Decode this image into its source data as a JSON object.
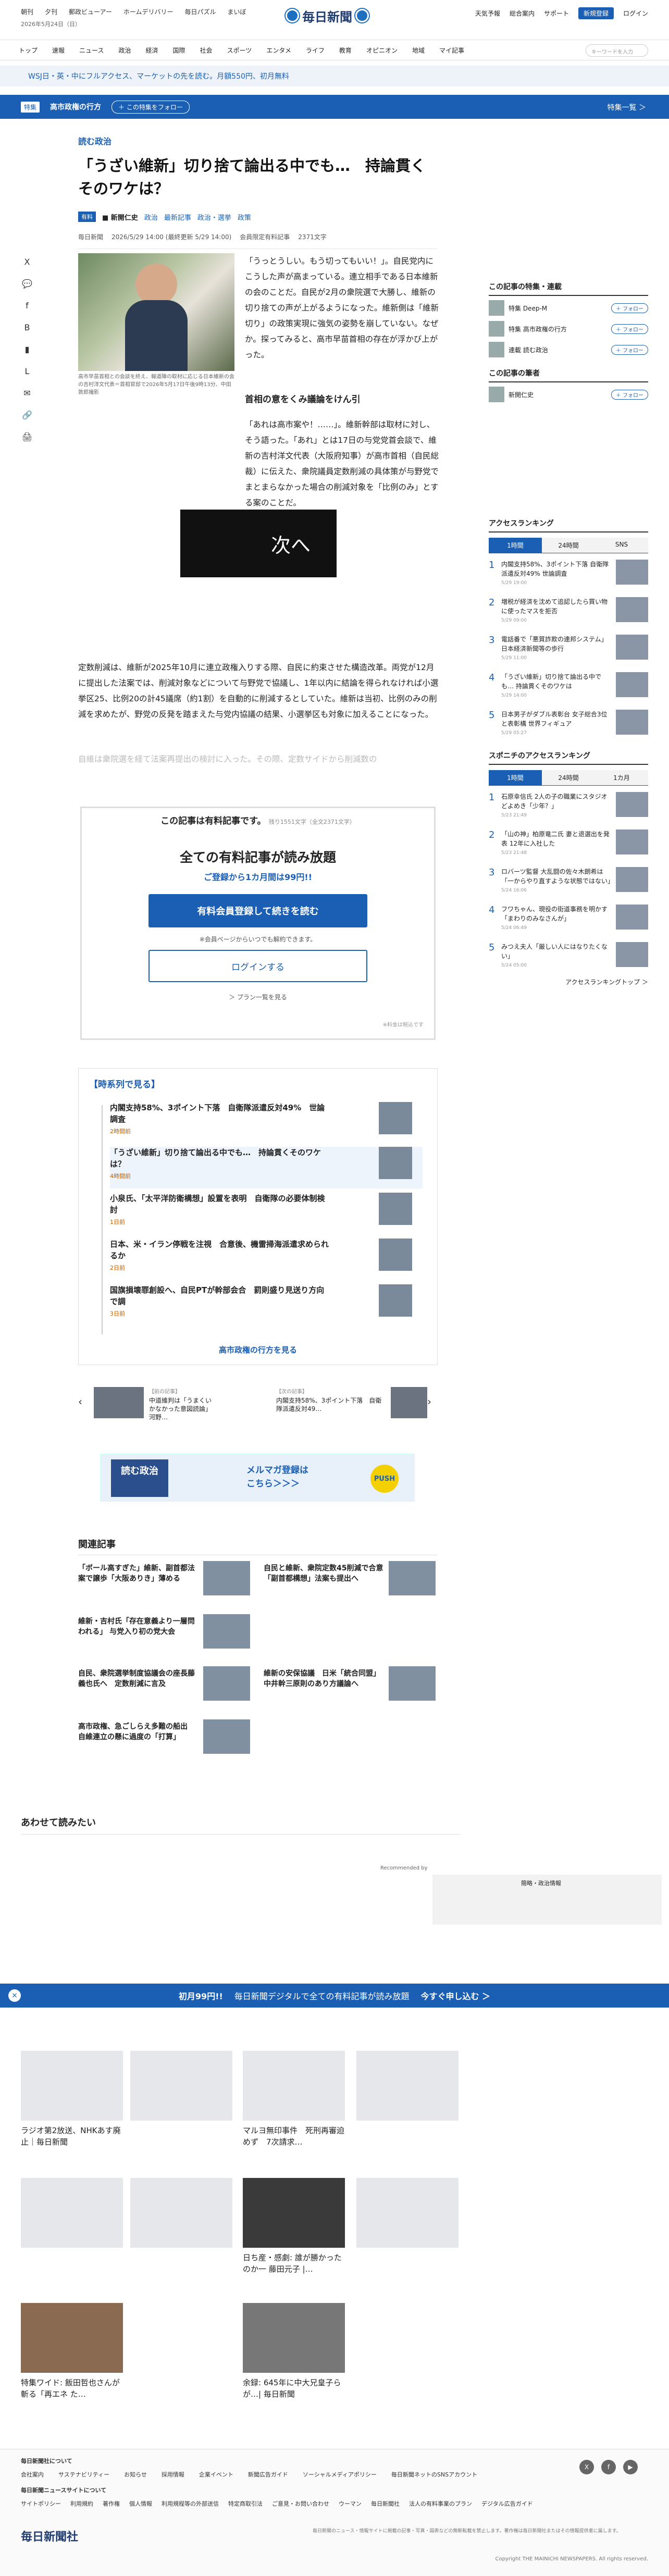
{
  "util": {
    "links": [
      "朝刊",
      "夕刊",
      "郵政ビューアー",
      "ホームデリバリー",
      "毎日パズル",
      "まいぼ"
    ],
    "date": "2026年5月24日（日）",
    "logo": "毎日新聞",
    "right": [
      "天気予報",
      "総合案内",
      "サポート"
    ],
    "register": "新規登録",
    "login": "ログイン"
  },
  "gnav": {
    "items": [
      "トップ",
      "速報",
      "ニュース",
      "政治",
      "経済",
      "国際",
      "社会",
      "スポーツ",
      "エンタメ",
      "ライフ",
      "教育",
      "オピニオン",
      "地域",
      "マイ記事"
    ],
    "search_placeholder": "キーワードを入力"
  },
  "ticker": "WSJ日・英・中にフルアクセス、マーケットの先を読む。月額550円、初月無料",
  "topic": {
    "tag": "特集",
    "name": "高市政権の行方",
    "follow": "＋ この特集をフォロー",
    "special": "特集一覧 ＞"
  },
  "article": {
    "kicker": "読む政治",
    "title": "「うざい維新」切り捨て論出る中でも…　持論貫くそのワケは？",
    "badge": "有料",
    "author": "■ 新開仁史",
    "tags": [
      "政治",
      "最新記事",
      "政治・選挙",
      "政策"
    ],
    "paper": "毎日新聞",
    "dates": "2026/5/29 14:00 (最終更新 5/29 14:00)",
    "members": "会員限定有料記事",
    "chars": "2371文字",
    "caption": "高市早苗首相との会談を終え、報道陣の取材に応じる日本維新の会の吉村洋文代表＝首相官邸で2026年5月17日午後9時13分、中田敦郎撮影",
    "lead": "「うっとうしい。もう切ってもいい！」。自民党内にこうした声が高まっている。連立相手である日本維新の会のことだ。自民が2月の衆院選で大勝し、維新の切り捨ての声が上がるようになった。維新側は「維新切り」の政策実現に強気の姿勢を崩していない。なぜか。探ってみると、高市早苗首相の存在が浮かび上がった。",
    "h2": "首相の意をくみ議論をけん引",
    "p2": "「あれは高市案や！……」。維新幹部は取材に対し、そう語った。「あれ」とは17日の与党党首会談で、維新の吉村洋文代表（大阪府知事）が高市首相（自民総裁）に伝えた、衆院議員定数削減の具体策が与野党でまとまらなかった場合の削減対象を「比例のみ」とする案のことだ。",
    "video": "次へ",
    "p4": "定数削減は、維新が2025年10月に連立政権入りする際、自民に約束させた構造改革。両党が12月に提出した法案では、削減対象などについて与野党で協議し、1年以内に結論を得られなければ小選挙区25、比例20の計45議席（約1割）を自動的に削減するとしていた。維新は当初、比例のみの削減を求めたが、野党の反発を踏まえた与党内協議の結果、小選挙区も対象に加えることになった。",
    "fade": "自維は衆院選を経て法案再提出の検討に入った。その際、定数サイドから削減数の"
  },
  "share": [
    "X",
    "f",
    "B",
    "L",
    "✉",
    "🔗",
    "🖨"
  ],
  "paywall": {
    "l1": "この記事は有料記事です。",
    "l1small": "残り1551文字（全文2371文字）",
    "l2": "全ての有料記事が読み放題",
    "l3": "ご登録から1カ月間は99円!!",
    "btn1": "有料会員登録して続きを読む",
    "l4": "※会員ページからいつでも解約できます。",
    "btn2": "ログインする",
    "l5": "＞ プラン一覧を見る",
    "l6": "※料金は税込です"
  },
  "timeline": {
    "head": "【時系列で見る】",
    "items": [
      {
        "title": "内閣支持58%、3ポイント下落　自衛隊派遣反対49%　世論調査",
        "date": "2時間前"
      },
      {
        "title": "「うざい維新」切り捨て論出る中でも…　持論貫くそのワケは？",
        "date": "4時間前"
      },
      {
        "title": "小泉氏、「太平洋防衛構想」設置を表明　自衛隊の必要体制検討",
        "date": "1日前"
      },
      {
        "title": "日本、米・イラン停戦を注視　合意後、機雷掃海派遣求められるか",
        "date": "2日前"
      },
      {
        "title": "国旗損壊罪創設へ、自民PTが幹部会合　罰則盛り見送り方向で調",
        "date": "3日前"
      }
    ],
    "more": "高市政権の行方を見る"
  },
  "prevnext": [
    {
      "label": "【前の記事】",
      "title": "中道維判は「うまくいかなかった意図読論」 河野…"
    },
    {
      "label": "【次の記事】",
      "title": "内閣支持58%、3ポイント下落　自衛隊派遣反対49…"
    }
  ],
  "promo": {
    "badge": "読む政治",
    "text": "メルマガ登録は\nこちら＞＞＞",
    "push": "PUSH"
  },
  "related": {
    "head": "関連記事",
    "items": [
      "「ボール高すぎた」維新、副首都法案で譲歩「大阪ありき」薄める",
      "自民と維新、衆院定数45削減で合意「副首都構想」法案も提出へ",
      "維新・吉村氏「存在意義より一層問われる」 与党入り初の党大会",
      "",
      "自民、衆院選挙制度協議会の座長藤義也氏へ　定数削減に言及",
      "維新の安保協議　日米「統合同盟」中井幹三原則のあり方議論へ",
      "高市政権、急ごしらえ多難の船出　自維連立の懸に過度の「打算」",
      ""
    ]
  },
  "readalso": "あわせて読みたい",
  "recommended": {
    "label": "Recommended by",
    "ad": "簡略・政治情報"
  },
  "rec_grid": [
    {
      "title": "ラジオ第2放送、NHKあす廃止｜毎日新聞",
      "src": ""
    },
    {
      "title": "マルヨ無印事件　死刑再審迫めず　7次請求…",
      "src": ""
    },
    {
      "title": "",
      "src": ""
    },
    {
      "title": "",
      "src": ""
    },
    {
      "title": "日ち産・感劇: 誰が勝かったのか一 藤田元子 |…",
      "src": ""
    },
    {
      "title": "",
      "src": ""
    },
    {
      "title": "特集ワイド: 飯田哲也さんが斬る「再エネ た…",
      "src": ""
    },
    {
      "title": "余録: 645年に中大兄皇子らが…| 毎日新聞",
      "src": ""
    }
  ],
  "cta": {
    "l": "初月99円!!",
    "m": "毎日新聞デジタルで全ての有料記事が読み放題",
    "r": "今すぐ申し込む ＞",
    "close": "×"
  },
  "sidebar": {
    "follow_head": "この記事の特集・連載",
    "follows": [
      "特集 Deep-M",
      "特集 高市政権の行方",
      "連載 読む政治"
    ],
    "follow_btn": "＋ フォロー",
    "author_head": "この記事の筆者",
    "author": "新開仁史",
    "rank1_head": "アクセスランキング",
    "rank_tabs": [
      "1時間",
      "24時間",
      "SNS"
    ],
    "rank1": [
      {
        "t": "内閣支持58%、3ポイント下落 自衛隊派遣反対49% 世論調査",
        "d": "5/29 19:00"
      },
      {
        "t": "増税が経済を沈めて追認したら買い物に使ったマスを拒否",
        "d": "5/29 09:00"
      },
      {
        "t": "電話番で「悪質詐欺の連邦システム」日本経済新聞等の歩行",
        "d": "5/29 11:00"
      },
      {
        "t": "「うざい維新」切り捨て論出る中でも… 持論貫くそのワケは",
        "d": "5/29 14:00"
      },
      {
        "t": "日本男子がダブル表彰台 女子総合3位と表彰構 世界フィギュア",
        "d": "5/29 05:27"
      }
    ],
    "rank2_head": "スポニチのアクセスランキング",
    "rank2_tabs": [
      "1時間",
      "24時間",
      "1カ月"
    ],
    "rank2": [
      {
        "t": "石原幸信氏 2人の子の職業にスタジオどよめき「少年？」",
        "d": "5/23 21:49"
      },
      {
        "t": "「山の神」柏原竜二氏 妻と退選出を発表 12年に入社した",
        "d": "5/23 21:48"
      },
      {
        "t": "ロバーツ監督 大乱闘の佐々木朗希は「一からやり直すような状態ではない」",
        "d": "5/24 16:06"
      },
      {
        "t": "フワちゃん、現役の街道事務を明かす「まわりのみなさんが」",
        "d": "5/24 06:49"
      },
      {
        "t": "みつえ夫人「厳しい人にはなりたくない」",
        "d": "5/24 05:00"
      }
    ],
    "rank_more": "アクセスランキングトップ ＞"
  },
  "footer": {
    "row1": [
      "毎日新聞社について"
    ],
    "row2": [
      "会社案内",
      "サステナビリティー",
      "お知らせ",
      "採用情報",
      "企業イベント",
      "新聞広告ガイド",
      "ソーシャルメディアポリシー",
      "毎日新聞ネットのSNSアカウント"
    ],
    "row3": [
      "毎日新聞ニュースサイトについて"
    ],
    "row4": [
      "サイトポリシー",
      "利用規約",
      "著作権",
      "個人情報",
      "利用規程等の外部送信",
      "特定商取引法",
      "ご意見・お問い合わせ",
      "ウーマン",
      "毎日新聞社",
      "法人の有料事業のプラン",
      "デジタル広告ガイド"
    ],
    "logo": "毎日新聞社",
    "notice": "毎日新聞のニュース・情報サイトに掲載の記事・写真・図表などの無断転載を禁止します。著作権は毎日新聞社またはその情報提供者に属します。",
    "copy": "Copyright THE MAINICHI NEWSPAPERS. All rights reserved.",
    "social": [
      "X",
      "f",
      "▶"
    ]
  }
}
